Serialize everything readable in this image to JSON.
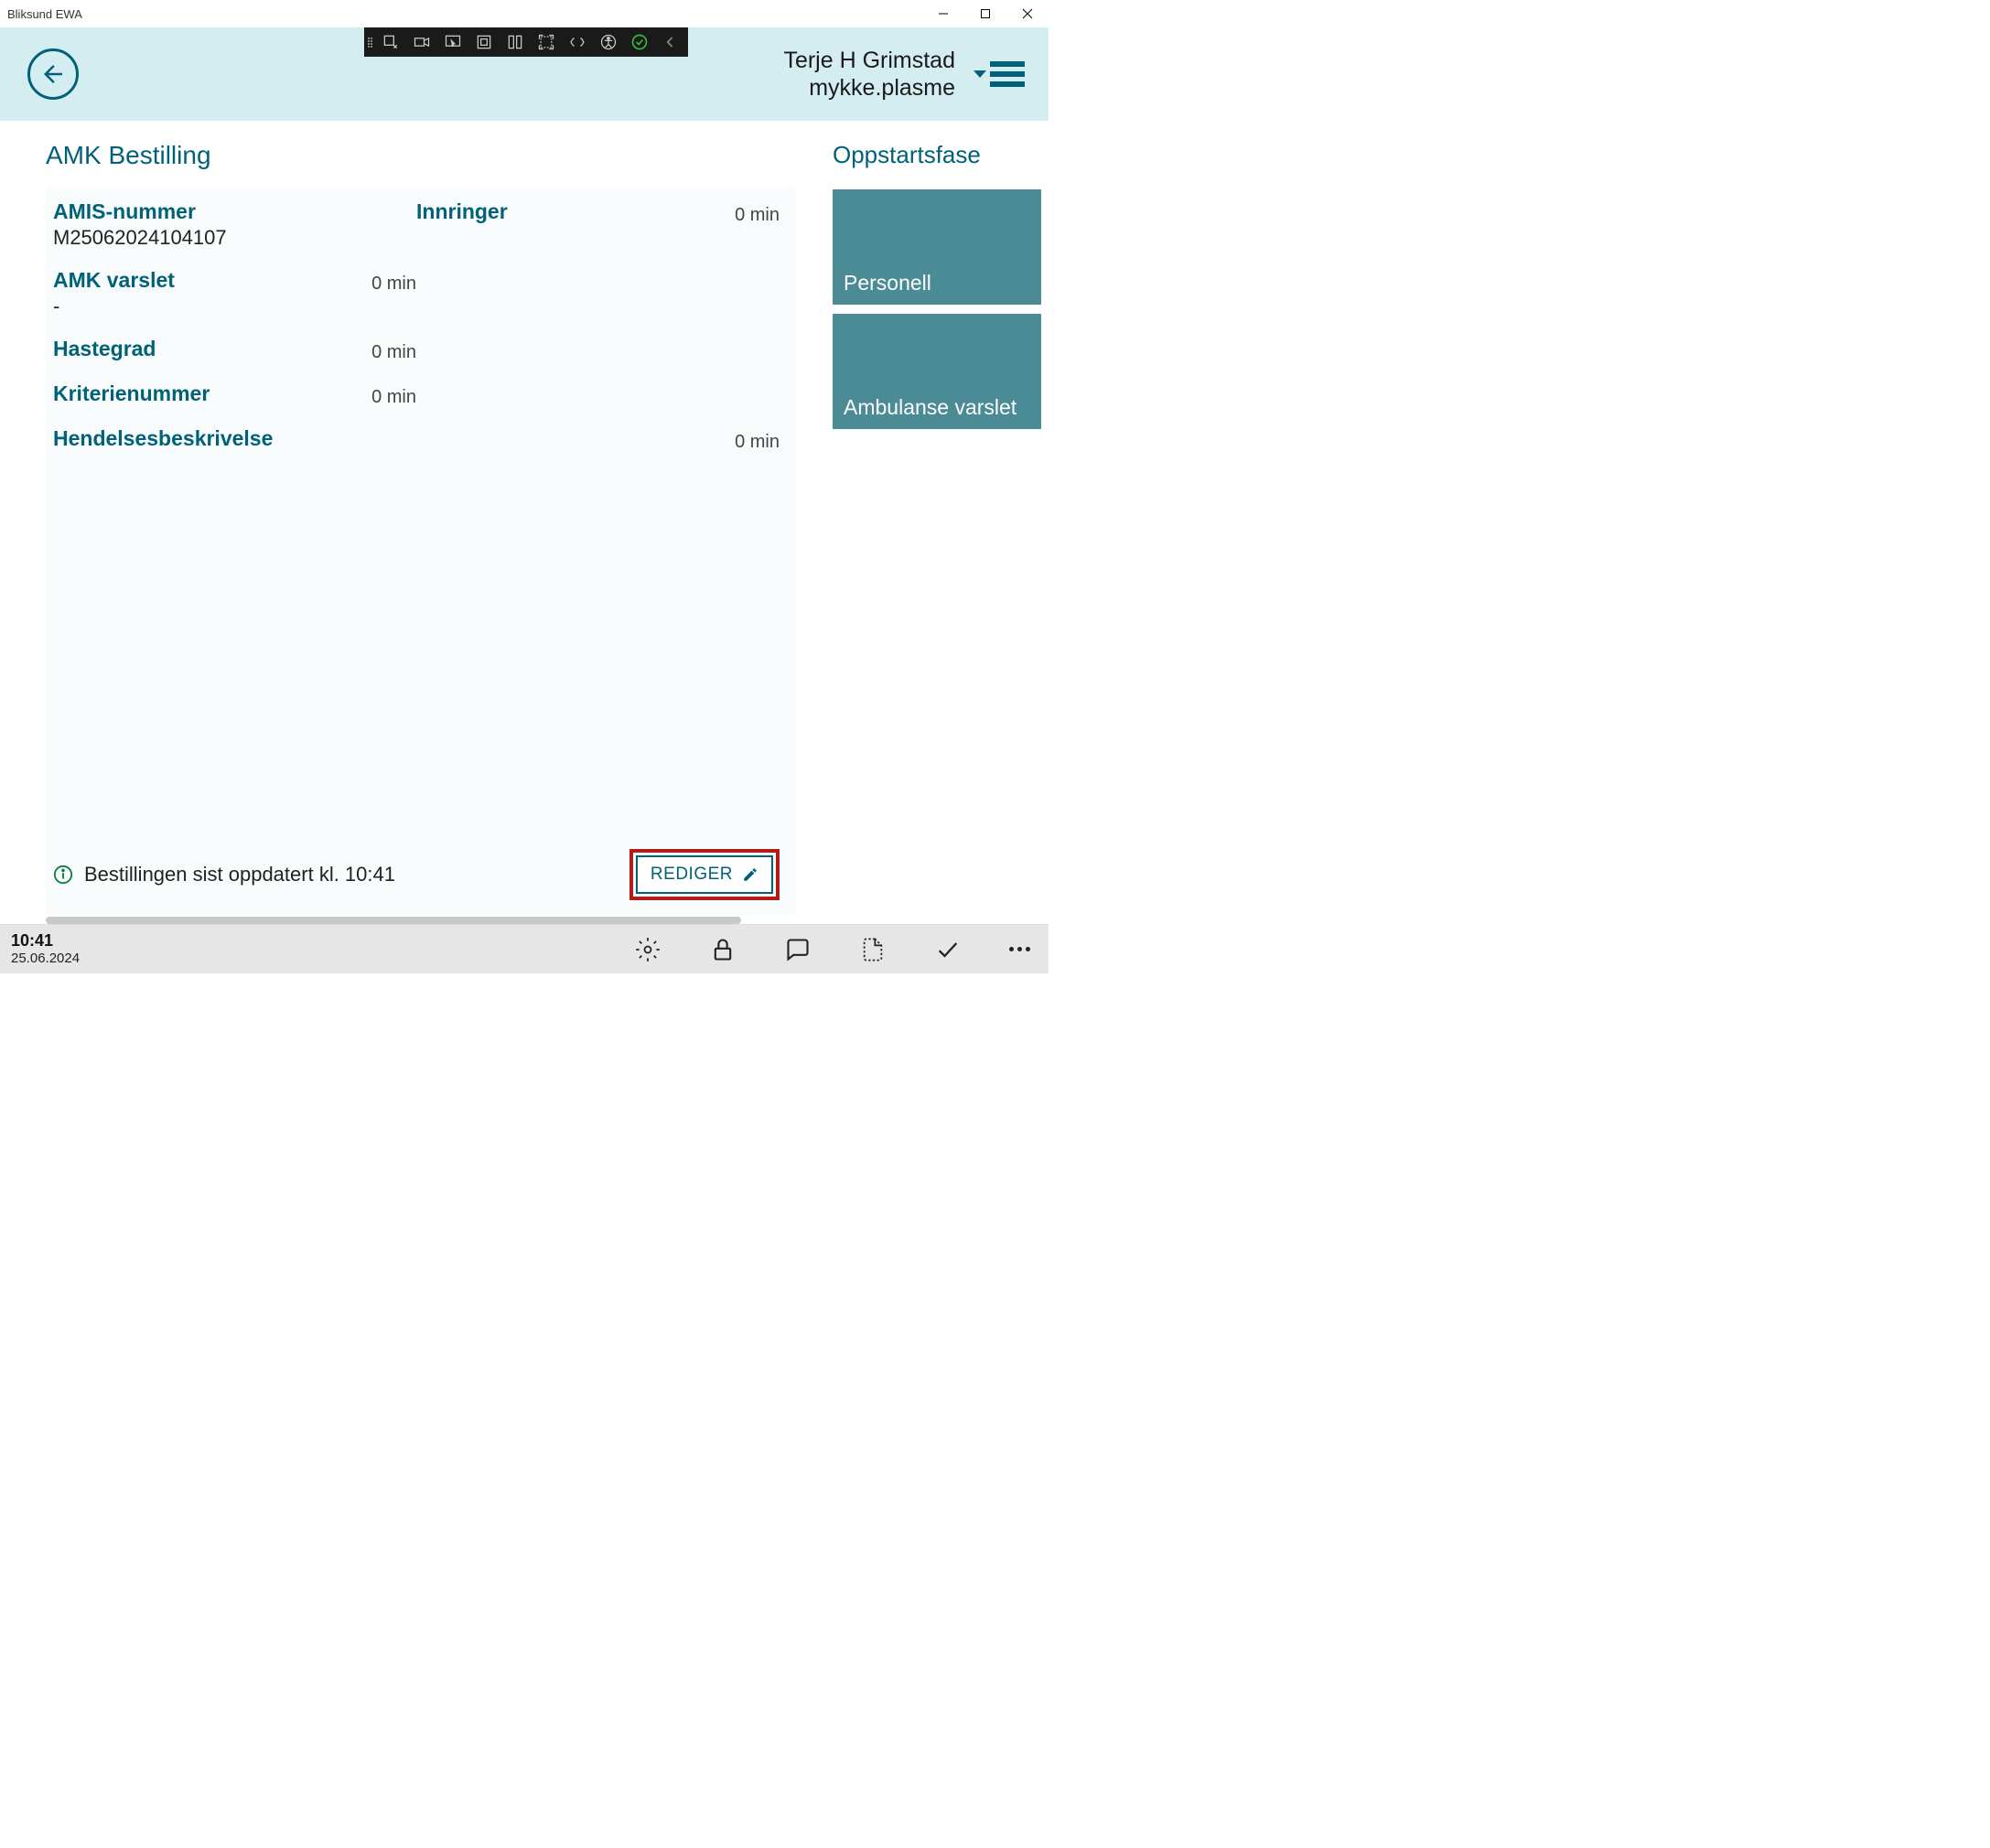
{
  "window": {
    "title": "Bliksund EWA"
  },
  "header": {
    "user_name": "Terje H Grimstad",
    "user_org": "mykke.plasme"
  },
  "page": {
    "title": "AMK Bestilling"
  },
  "fields": {
    "amis": {
      "label": "AMIS-nummer",
      "value": "M25062024104107"
    },
    "innringer": {
      "label": "Innringer",
      "time": "0 min"
    },
    "amk_varslet": {
      "label": "AMK varslet",
      "value": "-",
      "time": "0 min"
    },
    "hastegrad": {
      "label": "Hastegrad",
      "time": "0 min"
    },
    "kriterienummer": {
      "label": "Kriterienummer",
      "time": "0 min"
    },
    "hendelsesbeskrivelse": {
      "label": "Hendelsesbeskrivelse",
      "time": "0 min"
    }
  },
  "card_footer": {
    "text": "Bestillingen sist oppdatert kl. 10:41",
    "edit_label": "REDIGER"
  },
  "right": {
    "title": "Oppstartsfase",
    "tiles": [
      "Personell",
      "Ambulanse varslet"
    ]
  },
  "statusbar": {
    "time": "10:41",
    "date": "25.06.2024"
  }
}
